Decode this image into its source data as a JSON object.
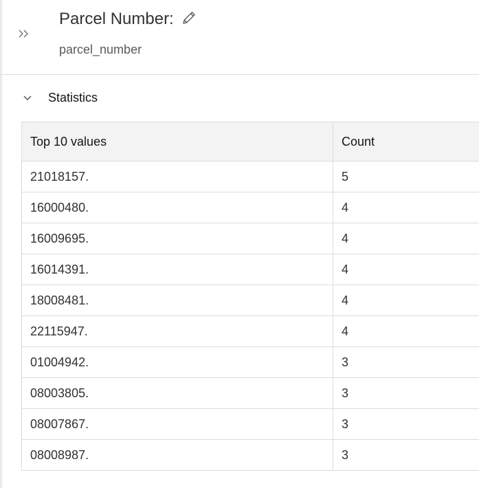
{
  "header": {
    "title": "Parcel Number:",
    "subtitle": "parcel_number"
  },
  "icons": {
    "expand": "double-chevron-right-icon",
    "edit": "pencil-icon",
    "collapse": "chevron-down-icon"
  },
  "statistics": {
    "section_title": "Statistics",
    "columns": [
      "Top 10 values",
      "Count"
    ],
    "rows": [
      {
        "value": "21018157.",
        "count": "5"
      },
      {
        "value": "16000480.",
        "count": "4"
      },
      {
        "value": "16009695.",
        "count": "4"
      },
      {
        "value": "16014391.",
        "count": "4"
      },
      {
        "value": "18008481.",
        "count": "4"
      },
      {
        "value": "22115947.",
        "count": "4"
      },
      {
        "value": "01004942.",
        "count": "3"
      },
      {
        "value": "08003805.",
        "count": "3"
      },
      {
        "value": "08007867.",
        "count": "3"
      },
      {
        "value": "08008987.",
        "count": "3"
      }
    ]
  }
}
